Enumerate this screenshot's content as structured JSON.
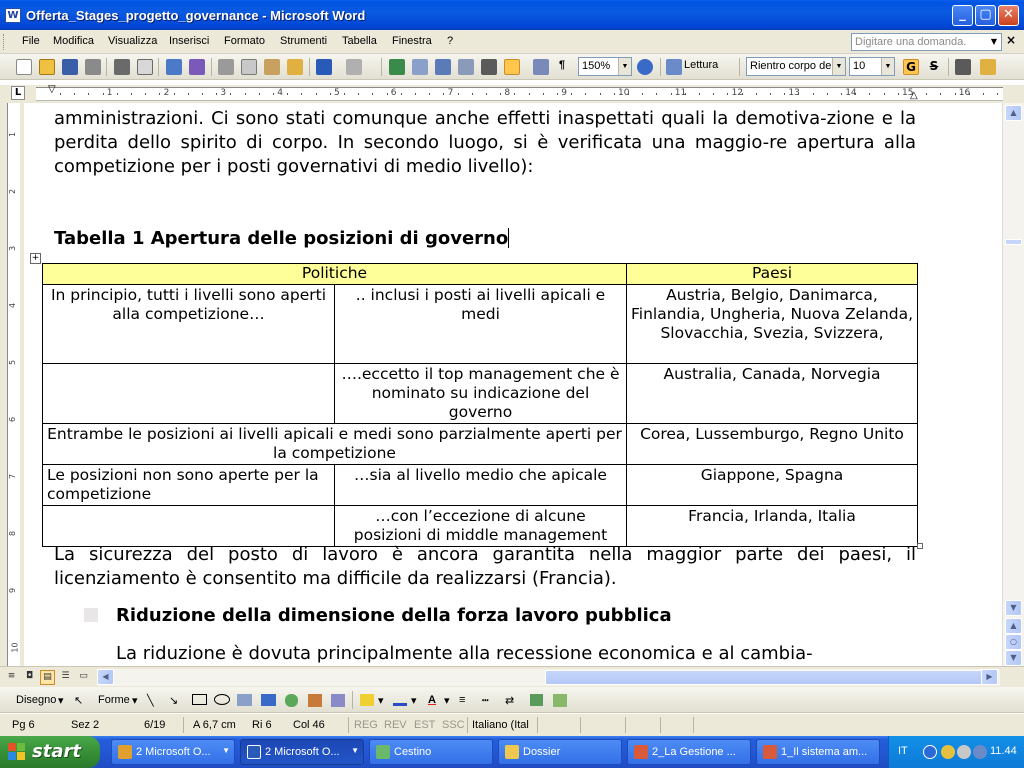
{
  "window": {
    "title": "Offerta_Stages_progetto_governance - Microsoft Word",
    "app_icon": "W"
  },
  "menu": {
    "items": [
      "File",
      "Modifica",
      "Visualizza",
      "Inserisci",
      "Formato",
      "Strumenti",
      "Tabella",
      "Finestra",
      "?"
    ],
    "ask_placeholder": "Digitare una domanda."
  },
  "toolbar": {
    "zoom": "150%",
    "reading_label": "Lettura",
    "style_value": "Rientro corpo de",
    "font_size": "10",
    "bold_label": "G",
    "strike_label": "S"
  },
  "ruler": {
    "numbers": [
      "1",
      "2",
      "3",
      "4",
      "5",
      "6",
      "7",
      "8",
      "9",
      "10",
      "11",
      "12",
      "13",
      "14",
      "15",
      "16"
    ],
    "tab_selector": "L"
  },
  "vruler": {
    "numbers": [
      "1",
      "2",
      "3",
      "4",
      "5",
      "6",
      "7",
      "8",
      "9",
      "10"
    ]
  },
  "document": {
    "paragraph1": "amministrazioni. Ci sono stati comunque anche effetti inaspettati quali la demotiva-zione e la perdita dello spirito di corpo. In secondo luogo, si è verificata una maggio-re apertura alla competizione per i posti governativi di medio livello):",
    "table_caption": "Tabella 1 Apertura delle posizioni di governo",
    "table": {
      "headers": [
        "Politiche",
        "Paesi"
      ],
      "rows": [
        {
          "c1": "In principio, tutti i livelli sono aperti alla competizione…",
          "c2": ".. inclusi i posti ai livelli apicali e medi",
          "c3": "Austria, Belgio, Danimarca, Finlandia, Ungheria, Nuova Zelanda, Slovacchia, Svezia, Svizzera,"
        },
        {
          "c1": "",
          "c2": "….eccetto il top management che è nominato  su indicazione del governo",
          "c3": "Australia, Canada, Norvegia"
        },
        {
          "c12": "Entrambe le posizioni ai livelli apicali e medi sono parzialmente aperti per la competizione",
          "c3": "Corea, Lussemburgo, Regno Unito"
        },
        {
          "c1": "Le posizioni non sono aperte per la competizione",
          "c2": "…sia al livello medio che apicale",
          "c3": "Giappone, Spagna"
        },
        {
          "c1": "",
          "c2": "…con l’eccezione di alcune posizioni di middle management",
          "c3": "Francia, Irlanda, Italia"
        }
      ]
    },
    "paragraph2": "La sicurezza del posto di lavoro è ancora garantita nella maggior parte dei paesi, il licenziamento è consentito ma difficile da realizzarsi (Francia).",
    "bullet_heading": "Riduzione della dimensione della forza lavoro pubblica",
    "paragraph3": "La riduzione è dovuta principalmente alla recessione economica e al cambia-"
  },
  "drawing": {
    "draw_label": "Disegno",
    "shapes_label": "Forme"
  },
  "status": {
    "page": "Pg 6",
    "section": "Sez 2",
    "pages": "6/19",
    "at": "A 6,7 cm",
    "line": "Ri 6",
    "col": "Col 46",
    "rec": "REG",
    "rev": "REV",
    "ext": "EST",
    "ovr": "SSC",
    "language": "Italiano (Ital"
  },
  "taskbar": {
    "start": "start",
    "tasks": [
      "2 Microsoft O...",
      "2 Microsoft O...",
      "Cestino",
      "Dossier",
      "2_La Gestione ...",
      "1_Il sistema am..."
    ],
    "lang": "IT",
    "clock": "11.44"
  },
  "colors": {
    "title_bar": "#0054e3",
    "table_header": "#ffff99",
    "taskbar": "#245edb",
    "start": "#379037"
  }
}
